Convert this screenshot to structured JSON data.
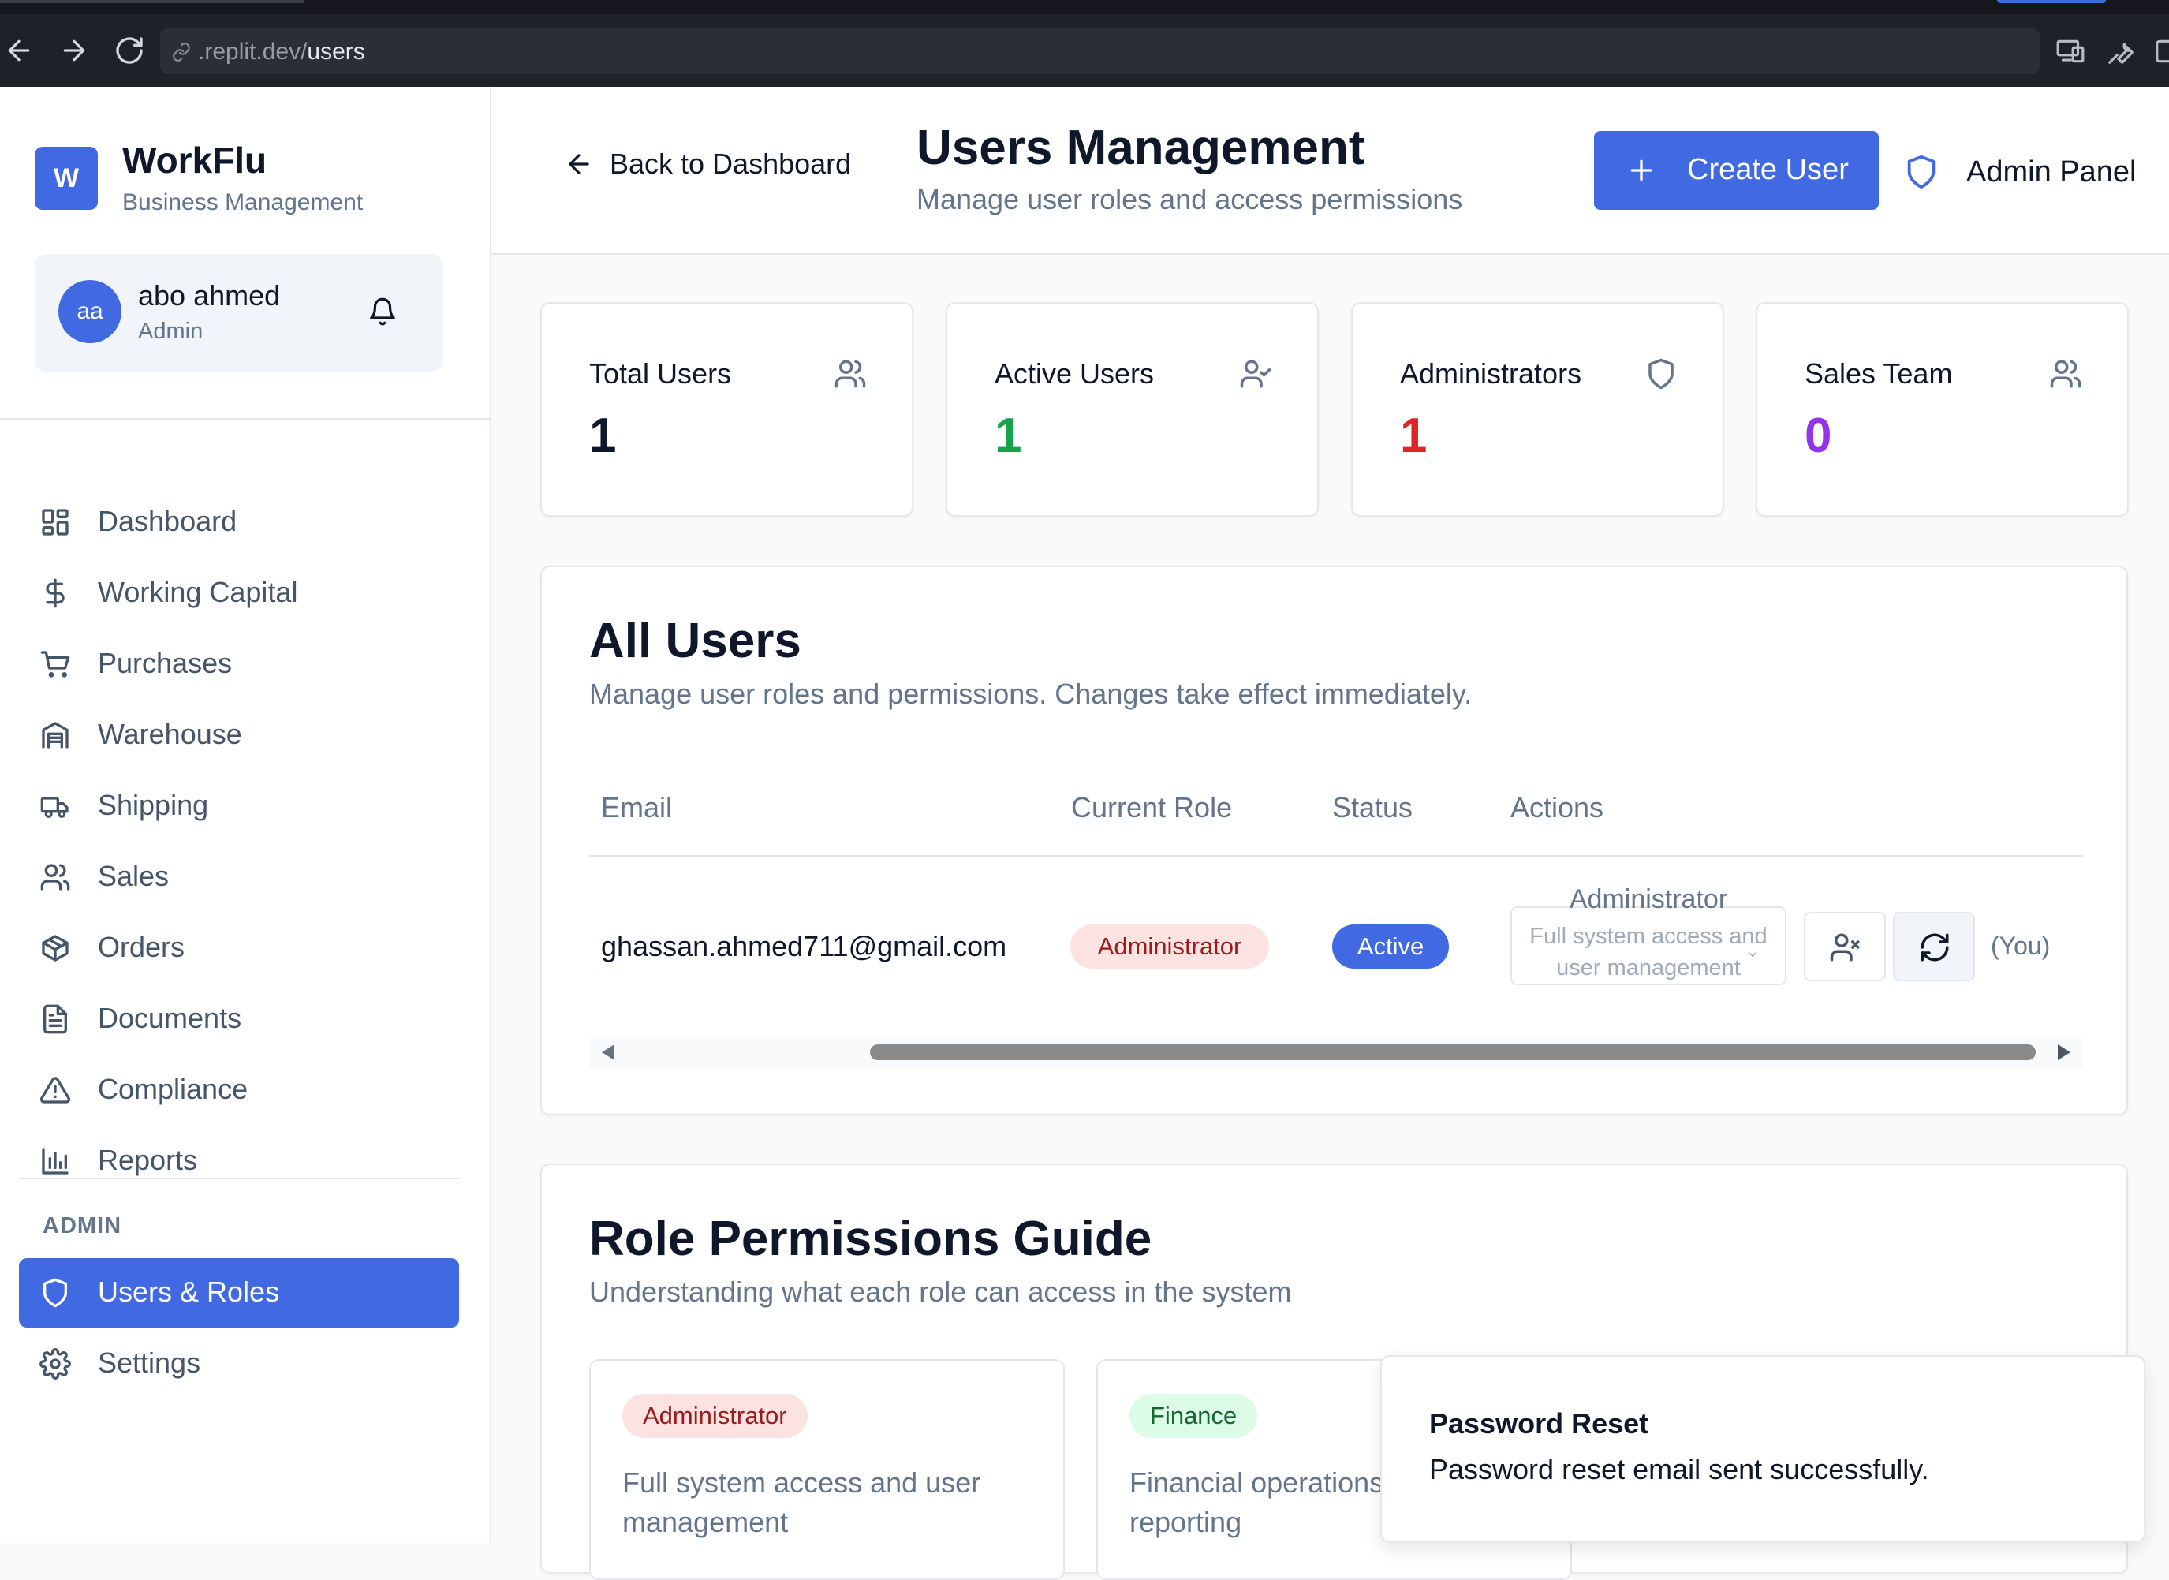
{
  "browser": {
    "url_prefix": ".replit.dev/",
    "url_path": "users"
  },
  "sidebar": {
    "logo_letter": "W",
    "app_name": "WorkFlu",
    "app_subtitle": "Business Management",
    "user": {
      "initials": "aa",
      "name": "abo ahmed",
      "role": "Admin"
    },
    "items": [
      {
        "label": "Dashboard",
        "icon": "dashboard-icon"
      },
      {
        "label": "Working Capital",
        "icon": "dollar-icon"
      },
      {
        "label": "Purchases",
        "icon": "cart-icon"
      },
      {
        "label": "Warehouse",
        "icon": "warehouse-icon"
      },
      {
        "label": "Shipping",
        "icon": "truck-icon"
      },
      {
        "label": "Sales",
        "icon": "users-icon"
      },
      {
        "label": "Orders",
        "icon": "package-icon"
      },
      {
        "label": "Documents",
        "icon": "document-icon"
      },
      {
        "label": "Compliance",
        "icon": "warning-icon"
      },
      {
        "label": "Reports",
        "icon": "bar-chart-icon"
      }
    ],
    "admin_section_label": "ADMIN",
    "admin_items": [
      {
        "label": "Users & Roles",
        "icon": "shield-icon",
        "active": true
      },
      {
        "label": "Settings",
        "icon": "gear-icon",
        "active": false
      }
    ]
  },
  "header": {
    "back_label": "Back to Dashboard",
    "title": "Users Management",
    "subtitle": "Manage user roles and access permissions",
    "create_label": "Create User",
    "admin_panel_label": "Admin Panel"
  },
  "stats": [
    {
      "label": "Total Users",
      "value": "1",
      "color": "#0f172a",
      "icon": "users-icon"
    },
    {
      "label": "Active Users",
      "value": "1",
      "color": "#16a34a",
      "icon": "user-check-icon"
    },
    {
      "label": "Administrators",
      "value": "1",
      "color": "#dc2626",
      "icon": "shield-icon"
    },
    {
      "label": "Sales Team",
      "value": "0",
      "color": "#9333ea",
      "icon": "users-icon"
    }
  ],
  "users_table": {
    "title": "All Users",
    "subtitle": "Manage user roles and permissions. Changes take effect immediately.",
    "columns": [
      "Email",
      "Current Role",
      "Status",
      "Actions"
    ],
    "rows": [
      {
        "email": "ghassan.ahmed711@gmail.com",
        "role": "Administrator",
        "status": "Active",
        "select_value": "Administrator",
        "select_description": "Full system access and user management",
        "you_label": "(You)"
      }
    ]
  },
  "permissions": {
    "title": "Role Permissions Guide",
    "subtitle": "Understanding what each role can access in the system",
    "roles": [
      {
        "name": "Administrator",
        "description": "Full system access and user management"
      },
      {
        "name": "Finance",
        "description": "Financial operations and reporting"
      }
    ]
  },
  "toast": {
    "title": "Password Reset",
    "message": "Password reset email sent successfully."
  },
  "colors": {
    "accent": "#4169e1",
    "admin_badge_bg": "#fde2e2",
    "finance_badge_bg": "#dcfce7"
  }
}
